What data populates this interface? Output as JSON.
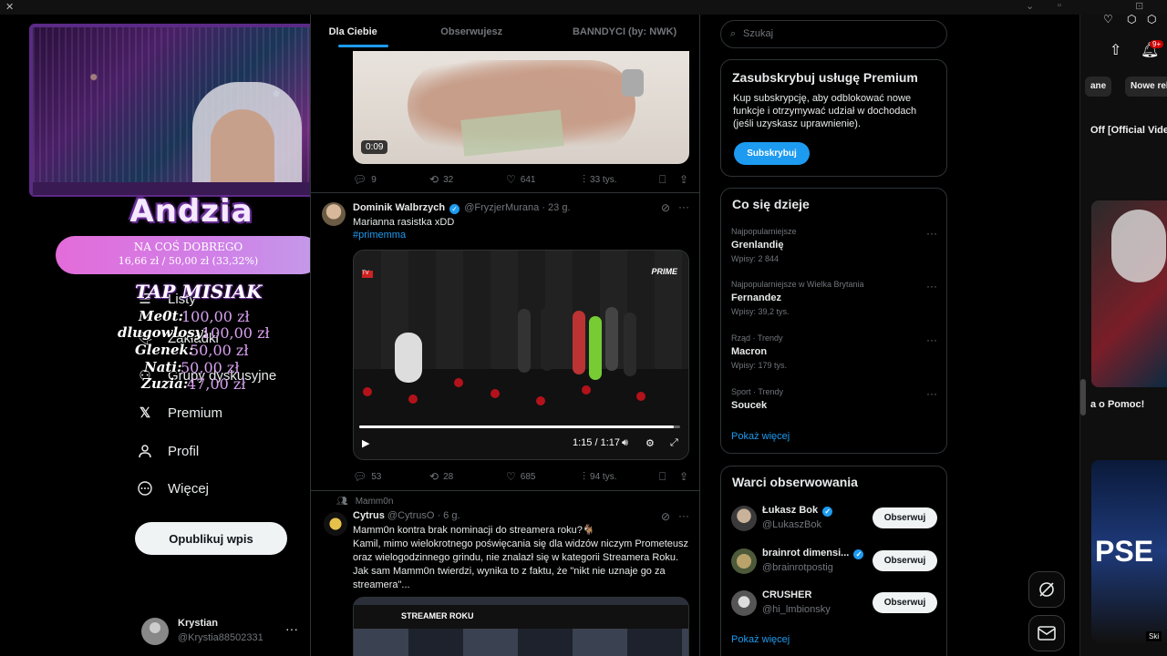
{
  "browser": {
    "close_glyph": "✕"
  },
  "nav": {
    "items": [
      {
        "label": "Listy"
      },
      {
        "label": "Zakładki"
      },
      {
        "label": "Grupy dyskusyjne"
      },
      {
        "label": "Premium"
      },
      {
        "label": "Profil"
      },
      {
        "label": "Więcej"
      }
    ],
    "publish": "Opublikuj wpis",
    "account": {
      "name": "Krystian",
      "handle": "@Krystia88502331",
      "more": "···"
    }
  },
  "overlay": {
    "streamer": "Andzia",
    "goal_title": "NA COŚ DOBREGO",
    "goal_progress": "16,66 zł  /  50,00 zł (33,32%)",
    "goal_fraction": 0.3332,
    "tap_title": "TAP MISIAK",
    "tap": [
      {
        "name": "Me0t:",
        "amount": "100,00 zł"
      },
      {
        "name": "dlugowlosy:",
        "amount": "100,00 zł"
      },
      {
        "name": "Glenek:",
        "amount": "50,00 zł"
      },
      {
        "name": "Nati:",
        "amount": "50,00 zł"
      },
      {
        "name": "Zuzia:",
        "amount": "47,00 zł"
      }
    ]
  },
  "feed": {
    "tabs": [
      "Dla Ciebie",
      "Obserwujesz",
      "BANNDYCI (by: NWK)"
    ],
    "post1": {
      "duration": "0:09",
      "replies": "9",
      "reposts": "32",
      "likes": "641",
      "views": "33 tys."
    },
    "post2": {
      "name": "Dominik Walbrzych",
      "handle": "@FryzjerMurana · 23 g.",
      "text": "Marianna rasistka xDD",
      "hashtag": "#primemma",
      "video_logo": "PRIME",
      "time": "1:15 / 1:17",
      "progress": 0.98,
      "replies": "53",
      "reposts": "28",
      "likes": "685",
      "views": "94 tys."
    },
    "post3": {
      "context": "Mamm0n",
      "name": "Cytrus",
      "handle": "@CytrusO · 6 g.",
      "text": "Mamm0n kontra brak nominacji do streamera roku?🐐\nKamil, mimo wielokrotnego poświęcania się dla widzów niczym Prometeusz oraz wielogodzinnego grindu, nie znalazł się w kategorii Streamera Roku. Jak sam Mamm0n twierdzi, wynika to z faktu, że \"nikt nie uznaje go za streamera\"...",
      "media_text": "STREAMER ROKU"
    }
  },
  "sidebar": {
    "search_placeholder": "Szukaj",
    "premium": {
      "title": "Zasubskrybuj usługę Premium",
      "desc": "Kup subskrypcję, aby odblokować nowe funkcje i otrzymywać udział w dochodach (jeśli uzyskasz uprawnienie).",
      "button": "Subskrybuj"
    },
    "trends_title": "Co się dzieje",
    "trends": [
      {
        "cat": "Najpopularniejsze",
        "title": "Grenlandię",
        "count": "Wpisy: 2 844"
      },
      {
        "cat": "Najpopularniejsze w Wielka Brytania",
        "title": "Fernandez",
        "count": "Wpisy: 39,2 tys."
      },
      {
        "cat": "Rząd · Trendy",
        "title": "Macron",
        "count": "Wpisy: 179 tys."
      },
      {
        "cat": "Sport · Trendy",
        "title": "Soucek",
        "count": ""
      }
    ],
    "show_more": "Pokaż więcej",
    "follow_title": "Warci obserwowania",
    "follow": [
      {
        "name": "Łukasz Bok",
        "handle": "@LukaszBok",
        "verified": true
      },
      {
        "name": "brainrot dimensi...",
        "handle": "@brainrotpostig",
        "verified": true
      },
      {
        "name": "CRUSHER",
        "handle": "@hi_lmbionsky",
        "verified": false
      }
    ],
    "follow_button": "Obserwuj"
  },
  "rightwin": {
    "chips": [
      "ane",
      "Nowe rek"
    ],
    "title1": "Off [Official Vide",
    "title2": "a o Pomoc!",
    "badge": "9+",
    "thumb_text": "PSE",
    "sk": "Ski"
  },
  "colors": {
    "accent": "#1d9bf0",
    "overlay_purple": "#5b2a86",
    "goal_pink": "#e36cd9"
  }
}
